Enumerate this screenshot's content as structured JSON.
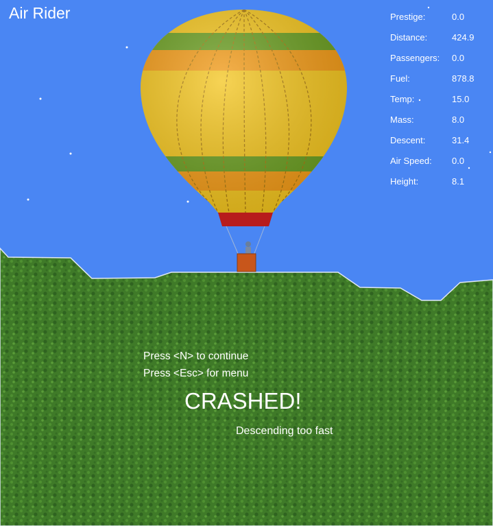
{
  "app": {
    "title": "Air Rider"
  },
  "hud": [
    {
      "label": "Prestige:",
      "value": "0.0"
    },
    {
      "label": "Distance:",
      "value": "424.9"
    },
    {
      "label": "Passengers:",
      "value": "0.0"
    },
    {
      "label": "Fuel:",
      "value": "878.8"
    },
    {
      "label": "Temp:",
      "value": "15.0"
    },
    {
      "label": "Mass:",
      "value": "8.0"
    },
    {
      "label": "Descent:",
      "value": "31.4"
    },
    {
      "label": "Air Speed:",
      "value": "0.0"
    },
    {
      "label": "Height:",
      "value": "8.1"
    }
  ],
  "messages": {
    "continue_hint": "Press <N> to continue",
    "menu_hint": "Press <Esc> for menu",
    "status": "CRASHED!",
    "reason": "Descending too fast"
  },
  "colors": {
    "sky": "#4a86f3",
    "grass": "#3f7a28",
    "balloon_yellow": "#f4c51c",
    "balloon_orange": "#f39a14",
    "balloon_green": "#6a9e1f",
    "skirt_red": "#b71c1c",
    "basket": "#c8561b"
  }
}
